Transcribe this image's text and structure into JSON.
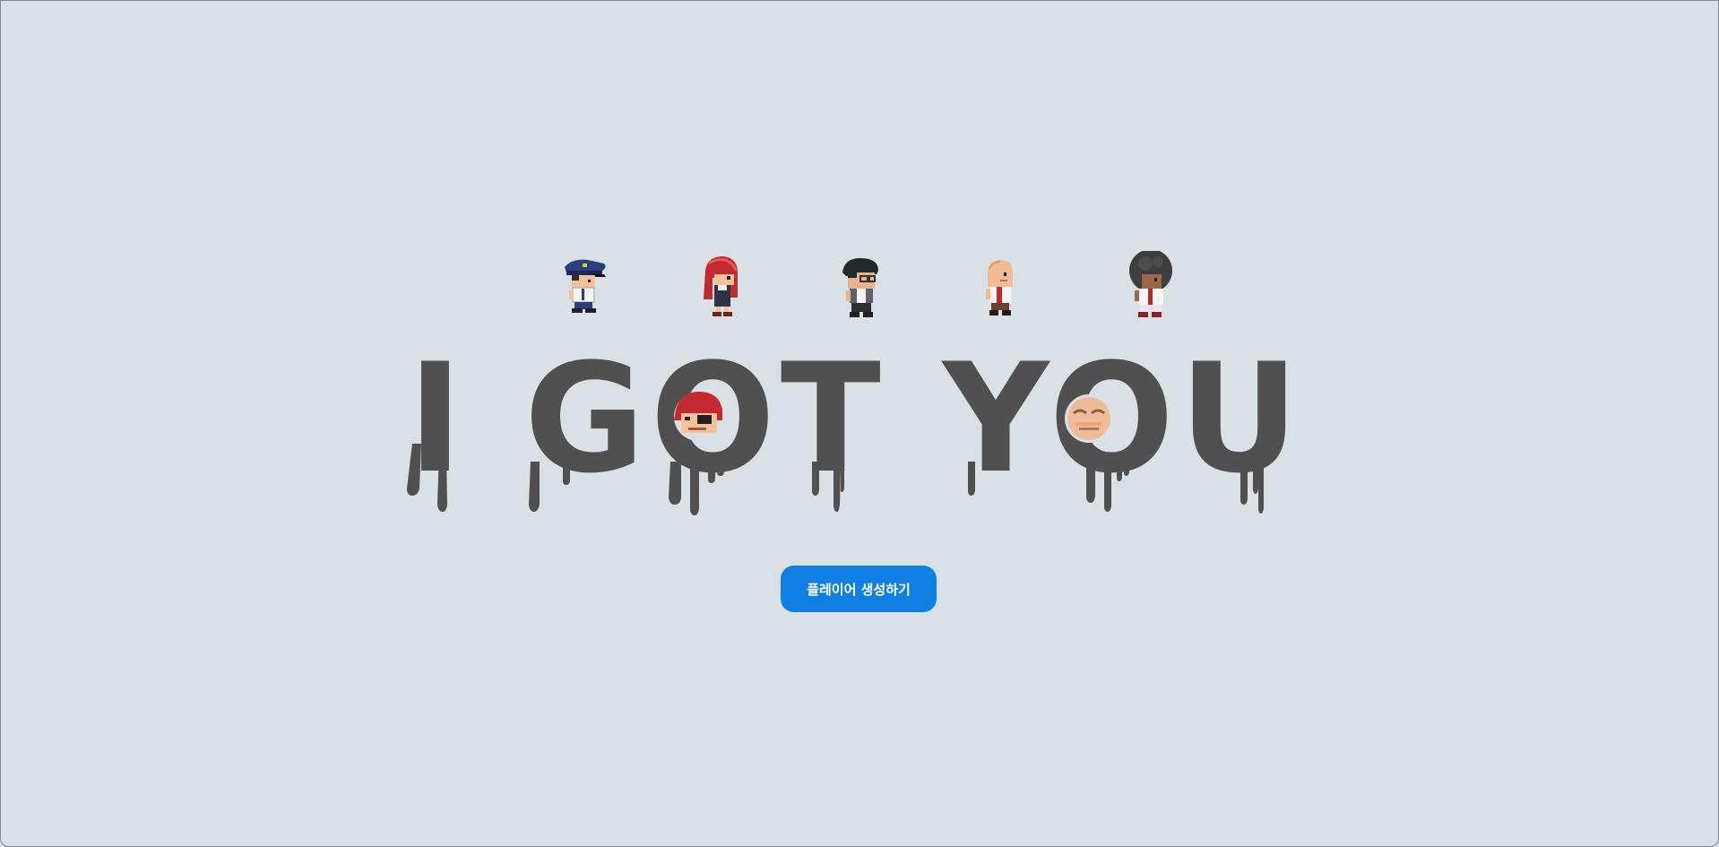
{
  "game": {
    "title": "I GOT YOU",
    "create_player_label": "플레이어 생성하기"
  },
  "characters": [
    {
      "name": "police-officer-character"
    },
    {
      "name": "red-hair-girl-character"
    },
    {
      "name": "glasses-boy-character"
    },
    {
      "name": "bald-man-character"
    },
    {
      "name": "afro-boy-character"
    }
  ],
  "colors": {
    "background": "#d9e0e6",
    "logo_ink": "#505050",
    "button": "#0f7fe3",
    "button_text": "#ffffff"
  }
}
